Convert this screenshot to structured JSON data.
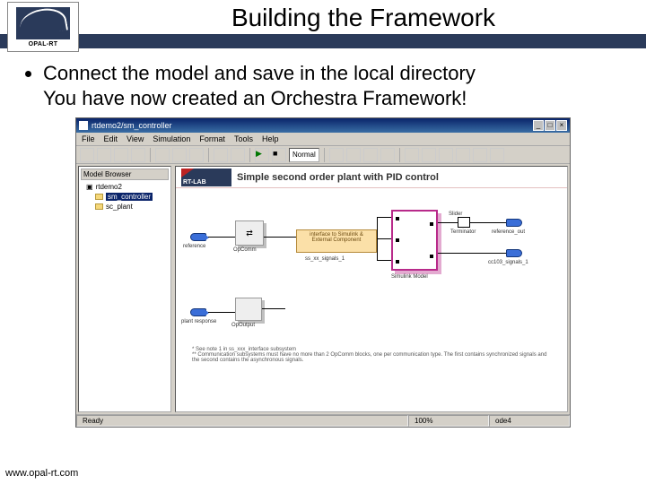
{
  "slide": {
    "logo_text": "OPAL-RT",
    "title": "Building the Framework",
    "bullet1": "Connect the model and save in the local directory",
    "bullet2": "You have now created an Orchestra Framework!",
    "footer_url": "www.opal-rt.com"
  },
  "app": {
    "window_title": "rtdemo2/sm_controller",
    "menu": {
      "file": "File",
      "edit": "Edit",
      "view": "View",
      "simulation": "Simulation",
      "format": "Format",
      "tools": "Tools",
      "help": "Help"
    },
    "toolbar": {
      "dropdown": "Normal"
    },
    "tree": {
      "panel_title": "Model Browser",
      "root": "rtdemo2",
      "item_selected": "sm_controller",
      "item2": "sc_plant"
    },
    "diagram": {
      "brand": "RT-LAB",
      "header_title": "Simple second order plant with PID control",
      "ref_label": "reference",
      "opcomm_label": "OpComm",
      "ext_conn_top": "interface to Simulink &",
      "ext_conn_bot": "External Component",
      "signals_label": "ss_xx_signals_1",
      "slider_label": "Slider",
      "simulink_label": "Simulink Model",
      "term_label": "Terminator",
      "out1_label": "reference_out",
      "out2_label": "cc103_signals_1",
      "plant_resp_label": "plant response",
      "out_block_label": "OpOutput",
      "note1": "* See note 1 in ss_xxx_interface subsystem",
      "note2": "** Communication subsystems must have no more than 2 OpComm blocks, one per communication type. The first contains synchronized signals and the second contains the asynchronous signals."
    },
    "statusbar": {
      "ready": "Ready",
      "zoom": "100%",
      "solver": "ode4"
    }
  }
}
